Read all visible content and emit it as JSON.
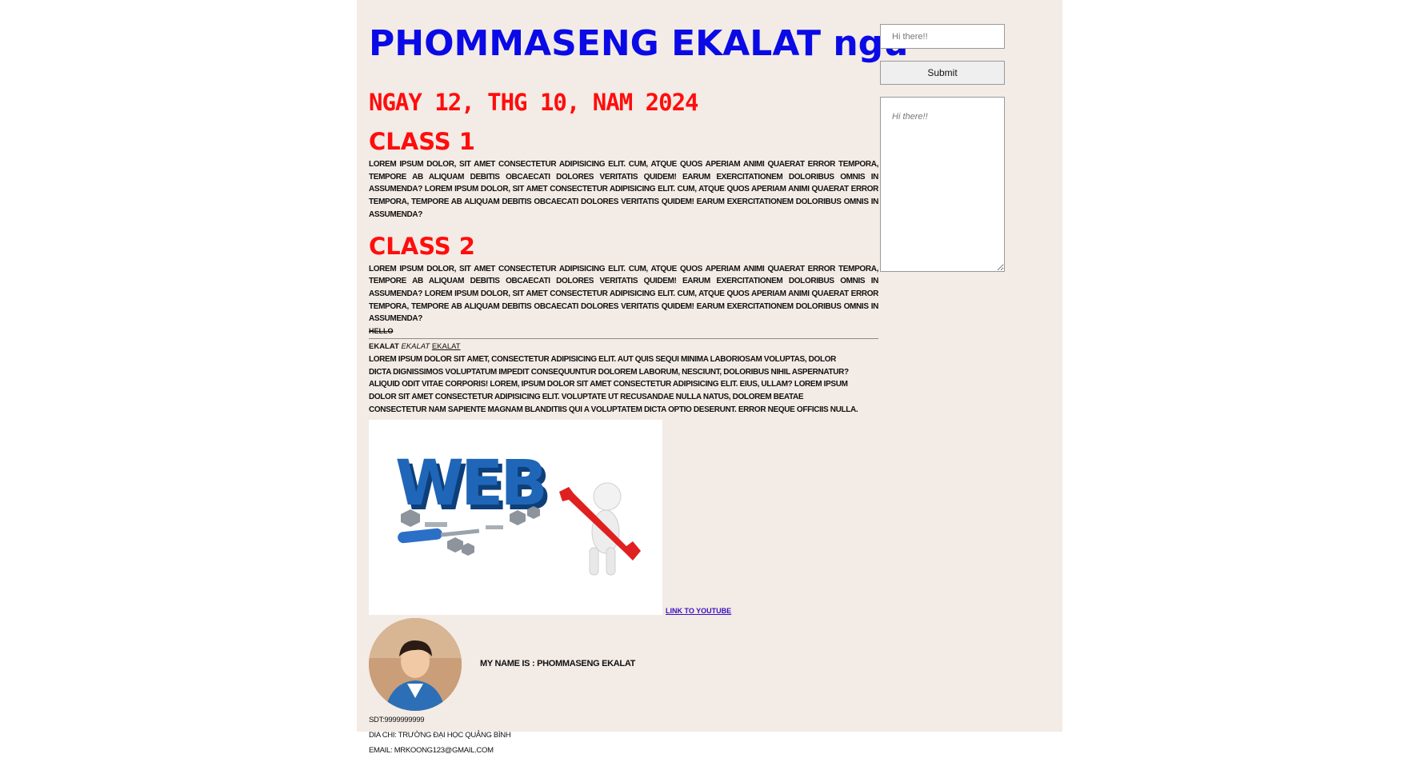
{
  "header": {
    "title": "PHOMMASENG EKALAT ngu",
    "date": "Ngay 12, thg 10, nam 2024"
  },
  "classes": [
    {
      "heading": "Class 1",
      "text": "Lorem ipsum dolor, sit amet consectetur adipisicing elit. Cum, atque quos aperiam animi quaerat error tempora, tempore ab aliquam debitis obcaecati dolores veritatis quidem! Earum exercitationem doloribus omnis in assumenda? Lorem ipsum dolor, sit amet consectetur adipisicing elit. Cum, atque quos aperiam animi quaerat error tempora, tempore ab aliquam debitis obcaecati dolores veritatis quidem! Earum exercitationem doloribus omnis in assumenda?"
    },
    {
      "heading": "Class 2",
      "text": "Lorem ipsum dolor, sit amet consectetur adipisicing elit. Cum, atque quos aperiam animi quaerat error tempora, tempore ab aliquam debitis obcaecati dolores veritatis quidem! Earum exercitationem doloribus omnis in assumenda? Lorem ipsum dolor, sit amet consectetur adipisicing elit. Cum, atque quos aperiam animi quaerat error tempora, tempore ab aliquam debitis obcaecati dolores veritatis quidem! Earum exercitationem doloribus omnis in assumenda?"
    }
  ],
  "hello": "Hello",
  "names": {
    "bold": "Ekalat",
    "italic": "Ekalat",
    "underline": "Ekalat"
  },
  "paragraph": "Lorem ipsum dolor sit amet, consectetur adipisicing elit. Aut quis sequi minima laboriosam voluptas, dolor dicta dignissimos voluptatum impedit consequuntur dolorem laborum, nesciunt, doloribus nihil aspernatur? Aliquid odit vitae corporis! Lorem, ipsum dolor sit amet consectetur adipisicing elit. Eius, ullam? Lorem ipsum dolor sit amet consectetur adipisicing elit. Voluptate ut recusandae nulla natus, dolorem beatae consectetur nam sapiente magnam blanditiis qui a voluptatem dicta optio deserunt. Error neque officiis nulla.",
  "image": {
    "logo_text": "WEB"
  },
  "link": {
    "label": "Link to youtube"
  },
  "profile": {
    "name_line": "My name is : PHOMMASENG EKALAT"
  },
  "contact": {
    "phone": "SDT:9999999999",
    "address": "Dia chi: Trường Đại Học Quảng Bình",
    "email": "Email: mrkoong123@gmail.com"
  },
  "form": {
    "input_placeholder": "Hi there!!",
    "submit_label": "Submit",
    "textarea_placeholder": "Hi there!!"
  },
  "colors": {
    "page_background": "#f3ebe5",
    "title": "#0a0ae6",
    "headings": "#ff0d0d",
    "link": "#3b0fbf"
  }
}
